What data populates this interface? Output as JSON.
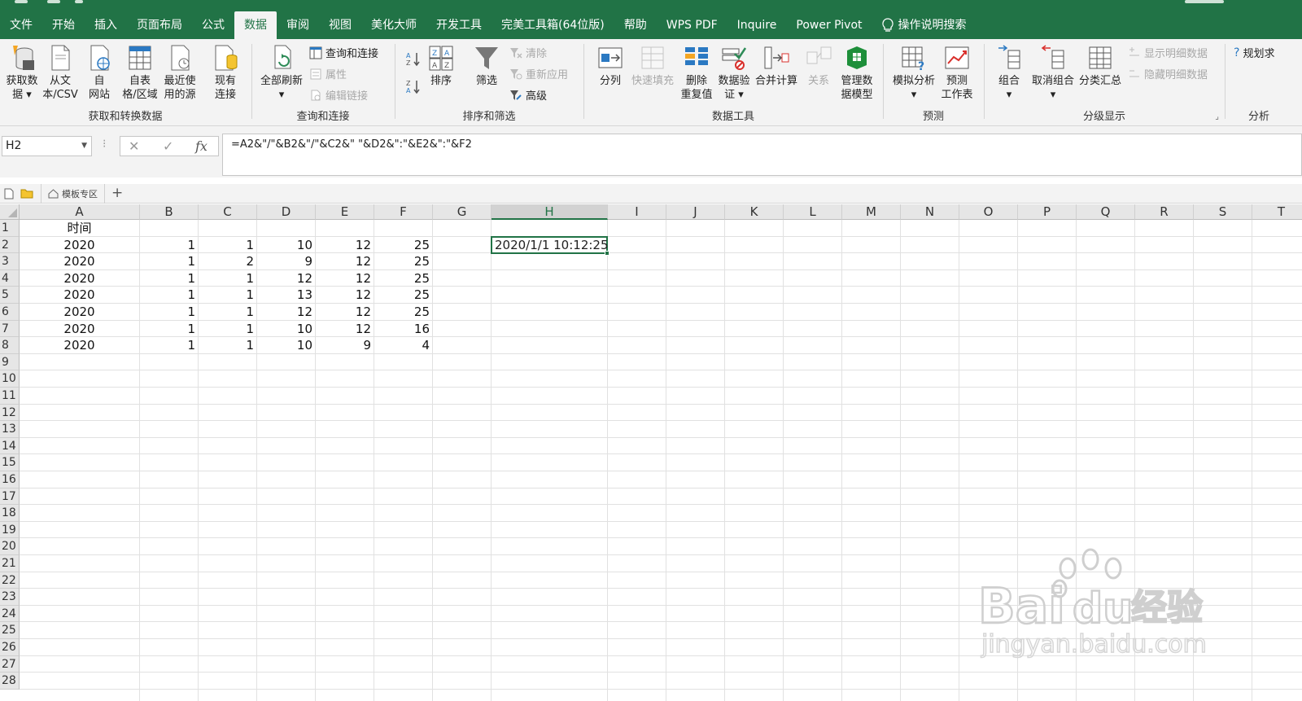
{
  "ribbon_tabs": [
    "文件",
    "开始",
    "插入",
    "页面布局",
    "公式",
    "数据",
    "审阅",
    "视图",
    "美化大师",
    "开发工具",
    "完美工具箱(64位版)",
    "帮助",
    "WPS PDF",
    "Inquire",
    "Power Pivot"
  ],
  "active_tab_index": 5,
  "tell_me": "操作说明搜索",
  "groups": {
    "get_data": {
      "label": "获取和转换数据",
      "buttons": [
        "获取数\n据 ▾",
        "从文\n本/CSV",
        "自\n网站",
        "自表\n格/区域",
        "最近使\n用的源",
        "现有\n连接"
      ]
    },
    "queries": {
      "label": "查询和连接",
      "refresh_all": "全部刷新\n▾",
      "query_connections": "查询和连接",
      "properties": "属性",
      "edit_links": "编辑链接"
    },
    "sort_filter": {
      "label": "排序和筛选",
      "sort": "排序",
      "filter": "筛选",
      "clear": "清除",
      "reapply": "重新应用",
      "advanced": "高级"
    },
    "data_tools": {
      "label": "数据工具",
      "buttons": [
        "分列",
        "快速填充",
        "删除\n重复值",
        "数据验\n证 ▾",
        "合并计算",
        "关系",
        "管理数\n据模型"
      ]
    },
    "forecast": {
      "label": "预测",
      "buttons": [
        "模拟分析\n▾",
        "预测\n工作表"
      ]
    },
    "outline": {
      "label": "分级显示",
      "buttons": [
        "组合\n▾",
        "取消组合\n▾",
        "分类汇总"
      ],
      "show_detail": "显示明细数据",
      "hide_detail": "隐藏明细数据"
    },
    "analysis": {
      "label": "分析",
      "planning": "规划求"
    }
  },
  "name_box": "H2",
  "formula": "=A2&\"/\"&B2&\"/\"&C2&\" \"&D2&\":\"&E2&\":\"&F2",
  "sheet_tab_label": "模板专区",
  "columns": [
    "A",
    "B",
    "C",
    "D",
    "E",
    "F",
    "G",
    "H",
    "I",
    "J",
    "K",
    "L",
    "M",
    "N",
    "O",
    "P",
    "Q",
    "R",
    "S",
    "T"
  ],
  "selected_column": "H",
  "row_count": 28,
  "header_cell": "时间",
  "rows": [
    [
      "2020",
      "1",
      "1",
      "10",
      "12",
      "25"
    ],
    [
      "2020",
      "1",
      "2",
      "9",
      "12",
      "25"
    ],
    [
      "2020",
      "1",
      "1",
      "12",
      "12",
      "25"
    ],
    [
      "2020",
      "1",
      "1",
      "13",
      "12",
      "25"
    ],
    [
      "2020",
      "1",
      "1",
      "12",
      "12",
      "25"
    ],
    [
      "2020",
      "1",
      "1",
      "10",
      "12",
      "16"
    ],
    [
      "2020",
      "1",
      "1",
      "10",
      "9",
      "4"
    ]
  ],
  "selected_cell_value": "2020/1/1 10:12:25",
  "watermark": "Baidu经验 jingyan.baidu.com",
  "colors": {
    "excel_green": "#217346",
    "ribbon_bg": "#f3f3f3"
  }
}
